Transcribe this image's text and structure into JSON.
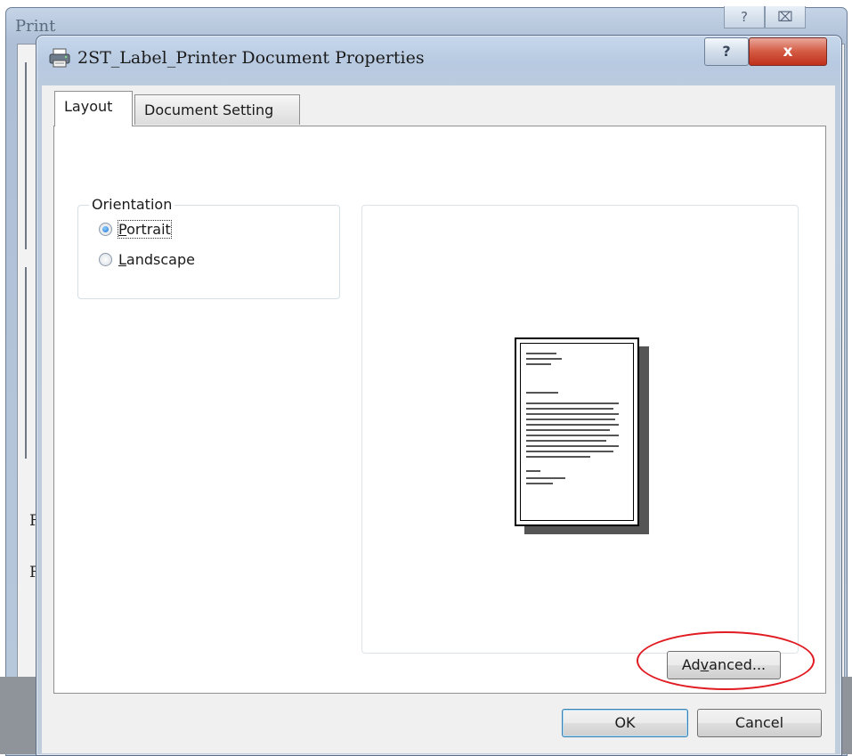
{
  "background_window": {
    "title": "Print",
    "help_glyph": "?",
    "close_glyph": "⌧",
    "side_letters": [
      "F",
      "F"
    ]
  },
  "dialog": {
    "title": "2ST_Label_Printer Document Properties",
    "help_glyph": "?",
    "close_glyph": "x",
    "icon": "printer-icon"
  },
  "tabs": [
    {
      "label": "Layout",
      "selected": true
    },
    {
      "label": "Document Setting",
      "selected": false
    }
  ],
  "orientation": {
    "legend": "Orientation",
    "options": [
      {
        "label_prefix": "",
        "label_accel": "P",
        "label_rest": "ortrait",
        "selected": true
      },
      {
        "label_prefix": "",
        "label_accel": "L",
        "label_rest": "andscape",
        "selected": false
      }
    ]
  },
  "buttons": {
    "advanced": {
      "prefix": "Ad",
      "accel": "v",
      "rest": "anced..."
    },
    "ok": "OK",
    "cancel": "Cancel"
  },
  "colors": {
    "highlight_ring": "#e11b22",
    "close_button": "#c0301c",
    "title_bar": "#b8cae1"
  }
}
